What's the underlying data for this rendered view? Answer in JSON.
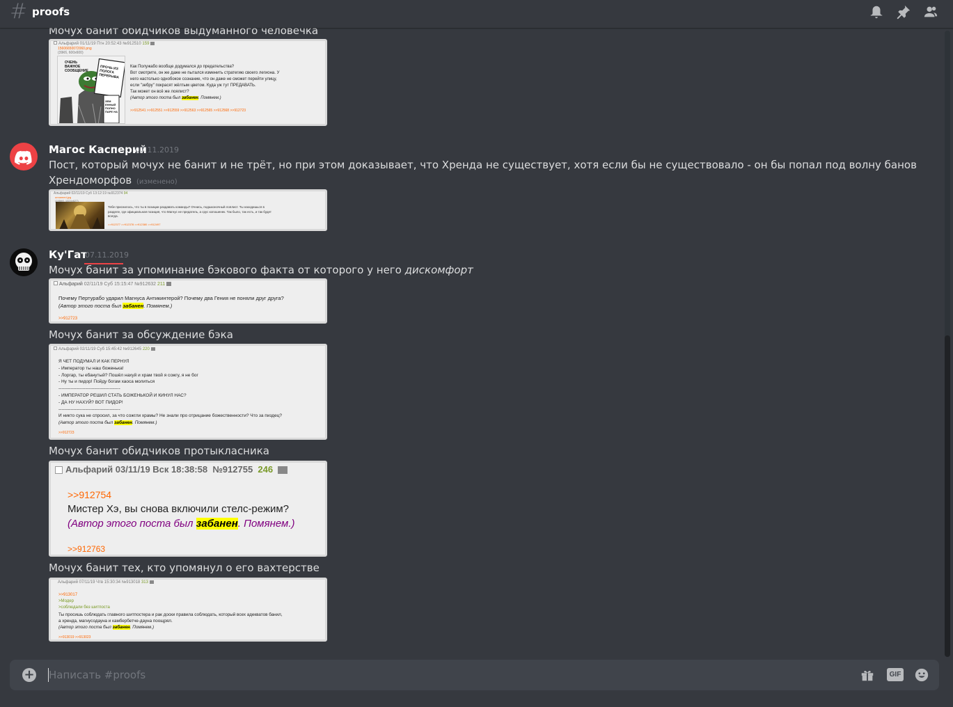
{
  "header": {
    "hash": "#",
    "channel": "proofs",
    "icons": [
      "bell-icon",
      "pin-icon",
      "members-icon"
    ]
  },
  "messages": {
    "m0_text": "Мочух банит обидчиков выдуманного человечка",
    "m1_user": "Магос Касперий",
    "m1_time": "07.11.2019",
    "m1_text_line1": "Пост, который мочух не банит и не трёт, но при этом доказывает, что Хренда не существует, хотя если бы не существовало - он бы попал под волну банов",
    "m1_text_line2": "Хрендоморфов",
    "m1_edited": "(изменено)",
    "m2_user": "Ку'Гат",
    "m2_time": "07.11.2019",
    "m2_text_plain": "Мочух банит за упоминание бэкового факта от которого у него ",
    "m2_text_italic": "дискомфорт",
    "m3_text": "Мочух банит за обсуждение бэка",
    "m4_text": "Мочух банит обидчиков протыкласника",
    "m5_text": "Мочух банит тех, кто упомянул о его вахтерстве"
  },
  "shots": {
    "s1": {
      "head": "Альфарий 01/11/19 Птн 20:52:43 №912510",
      "count": "159",
      "file": "15606650072060.png",
      "file_meta": "(39Кб, 600x600)",
      "meme_top": "ОЧЕНЬ ВАЖНОЕ СООБЩЕНИЕ",
      "meme_sign": "ПРОЧЬ ИЗ ПОЛОГА ПЕРЕРЫВА",
      "meme_sign2": "ЗЕМ ЕННЫЙ ПОЛНО ПАРЕ НА",
      "text_lines": [
        "Как Полужабо вообще додумался до предательства?",
        "Вот смотрите, он же даже не пытался изменить стратегию своего легиона. У",
        "него настолько однобокое сознание, что он даже не сможет перейти улицу,",
        "если \"зебру\" покрасят жёлтым цветом. Куда уж тут ПРЕДАВАТЬ.",
        "Так может он всё же лоялист?"
      ],
      "ban_pre": "(Автор этого поста был ",
      "ban_word": "забанен",
      "ban_post": ". Помянем.)",
      "refs": ">>912541 >>912551 >>912559 >>912563 >>912565 >>912568 >>912723"
    },
    "s2": {
      "head": "Альфарий 02/11/19 Суб 13:12:19 №912374",
      "count": "94",
      "file": "unnamed.jpg",
      "file_meta": "(195Кб, 1024x627)",
      "text_lines": [
        "Тебе приснилось, что ты в позиции раздавать команды? Очнись, подшконочный лоялист. Ты находишься в",
        "разделе, где официальная позиция, что Магнус не предатель, а срус копошенек. Так было, так есть, и так будет",
        "всегда."
      ],
      "refs": ">>912377 >>912378 >>912380 >>912497"
    },
    "s3": {
      "head_name": "Альфарий",
      "head_date": "02/11/19 Суб 15:15:47",
      "head_num": "№912632",
      "count": "211",
      "text": "Почему Пертурабо ударил Магнуса Антикинтерой? Почему два Гения не поняли друг друга?",
      "ban_pre": "(Автор этого поста был ",
      "ban_word": "забанен",
      "ban_post": ". Помянем.)",
      "refs": ">>912723"
    },
    "s4": {
      "head": "Альфарий 02/11/19 Суб 15:45:42 №912645",
      "count": "220",
      "text_lines": [
        "Я ЧЕТ ПОДУМАЛ И КАК ПЕРНУЛ",
        "- Император ты наш боженька!",
        "- Лоргар, ты ебанутый? Пошёл нахуй и храм твой я сожгу, я не бог",
        "- Ну ты и пидор! Пойду богам хаоса молиться",
        "-----------------------------------------",
        "- ИМПЕРАТОР РЕШИЛ СТАТЬ БОЖЕНЬКОЙ И КИНУЛ НАС?",
        "- ДА НУ НАХУЙ? ВОТ ПИДОР!",
        "-----------------------------------------",
        "И никто сука не спросил, за что сожгли храмы? Не знали про отрицание божественности? Что за пиздец?"
      ],
      "ban_pre": "(Автор этого поста был ",
      "ban_word": "забанен",
      "ban_post": ". Помянем.)",
      "refs": ">>912723"
    },
    "s5": {
      "head_name": "Альфарий",
      "head_date": "03/11/19 Вск 18:38:58",
      "head_num": "№912755",
      "count": "246",
      "ref_top": ">>912754",
      "text": "Мистер Хэ, вы снова включили стелс-режим?",
      "ban_pre": "(Автор этого поста был ",
      "ban_word": "забанен",
      "ban_post": ". Помянем.)",
      "refs": ">>912763"
    },
    "s6": {
      "head": "Альфарий 07/11/19 Чтв 15:30:34 №913018",
      "count": "313",
      "ref_top": ">>913017",
      "quote1": ">Модер",
      "quote2": ">соблюдали без шитпоста",
      "text_lines": [
        "Ты просишь соблюдать главного шитпостера и рак доски правила соблюдать, который всех адекватов банил,",
        "а хренда, магнусодауна и камбербетче-дауна поощрял."
      ],
      "ban_pre": "(Автор этого поста был ",
      "ban_word": "забанен",
      "ban_post": ". Помянем.)",
      "refs": ">>913019 >>913023"
    }
  },
  "composer": {
    "placeholder": "Написать #proofs",
    "icons": [
      "gift-icon",
      "gif-icon",
      "emoji-icon"
    ],
    "gif_label": "GIF",
    "plus_label": "+"
  },
  "colors": {
    "background": "#36393f",
    "composer": "#40444b",
    "discord_red": "#ed4245",
    "ref_orange": "#ff6600",
    "ban_purple": "#800080",
    "highlight": "#ffff00"
  }
}
